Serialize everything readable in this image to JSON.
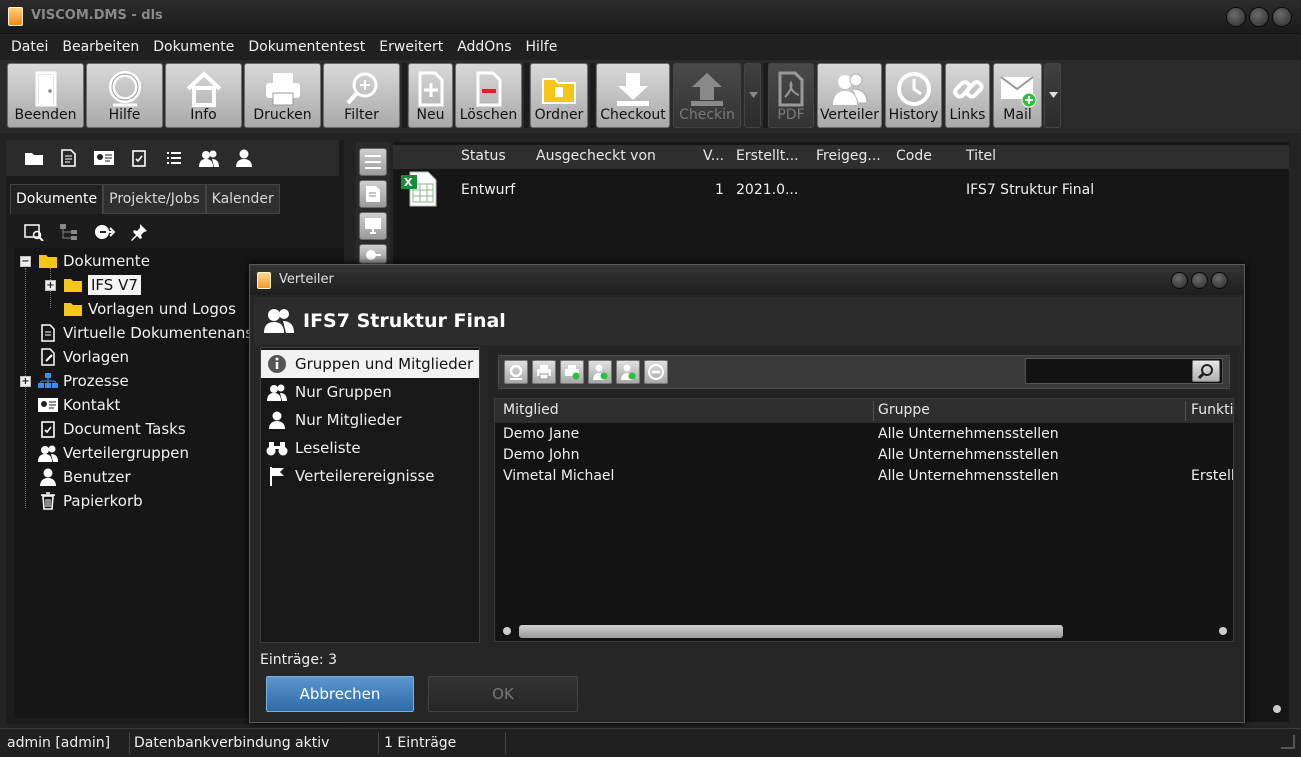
{
  "window": {
    "title": "VISCOM.DMS - dls"
  },
  "menu": [
    "Datei",
    "Bearbeiten",
    "Dokumente",
    "Dokumententest",
    "Erweitert",
    "AddOns",
    "Hilfe"
  ],
  "toolbar": {
    "beenden": "Beenden",
    "hilfe": "Hilfe",
    "info": "Info",
    "drucken": "Drucken",
    "filter": "Filter",
    "neu": "Neu",
    "loeschen": "Löschen",
    "ordner": "Ordner",
    "checkout": "Checkout",
    "checkin": "Checkin",
    "pdf": "PDF",
    "verteiler": "Verteiler",
    "history": "History",
    "links": "Links",
    "mail": "Mail"
  },
  "left": {
    "tabs": [
      "Dokumente",
      "Projekte/Jobs",
      "Kalender"
    ],
    "tree": {
      "dokumente": "Dokumente",
      "ifs": "IFS V7",
      "vorlagen_logos": "Vorlagen und Logos",
      "virtuell": "Virtuelle Dokumentenansic",
      "vorlagen": "Vorlagen",
      "prozesse": "Prozesse",
      "kontakt": "Kontakt",
      "tasks": "Document Tasks",
      "verteilergruppen": "Verteilergruppen",
      "benutzer": "Benutzer",
      "papierkorb": "Papierkorb"
    }
  },
  "doclist": {
    "columns": {
      "status": "Status",
      "ausgecheckt": "Ausgecheckt von",
      "version": "V...",
      "erstellt": "Erstellt...",
      "freigegeben": "Freigeg...",
      "code": "Code",
      "titel": "Titel"
    },
    "row": {
      "status": "Entwurf",
      "version": "1",
      "erstellt": "2021.0...",
      "titel": "IFS7 Struktur Final"
    }
  },
  "dialog": {
    "title": "Verteiler",
    "heading": "IFS7 Struktur Final",
    "nav": [
      "Gruppen und Mitglieder",
      "Nur Gruppen",
      "Nur Mitglieder",
      "Leseliste",
      "Verteilerereignisse"
    ],
    "table": {
      "columns": {
        "mitglied": "Mitglied",
        "gruppe": "Gruppe",
        "funktion": "Funkti"
      },
      "rows": [
        {
          "mitglied": "Demo Jane",
          "gruppe": "Alle Unternehmensstellen",
          "funktion": ""
        },
        {
          "mitglied": "Demo John",
          "gruppe": "Alle Unternehmensstellen",
          "funktion": ""
        },
        {
          "mitglied": "Vimetal Michael",
          "gruppe": "Alle Unternehmensstellen",
          "funktion": "Erstell"
        }
      ]
    },
    "count": "Einträge: 3",
    "cancel": "Abbrechen",
    "ok": "OK"
  },
  "status": {
    "user": "admin [admin]",
    "db": "Datenbankverbindung aktiv",
    "entries": "1 Einträge"
  },
  "colors": {
    "accent": "#3a78b6",
    "folder": "#f5c518",
    "background": "#232323"
  }
}
